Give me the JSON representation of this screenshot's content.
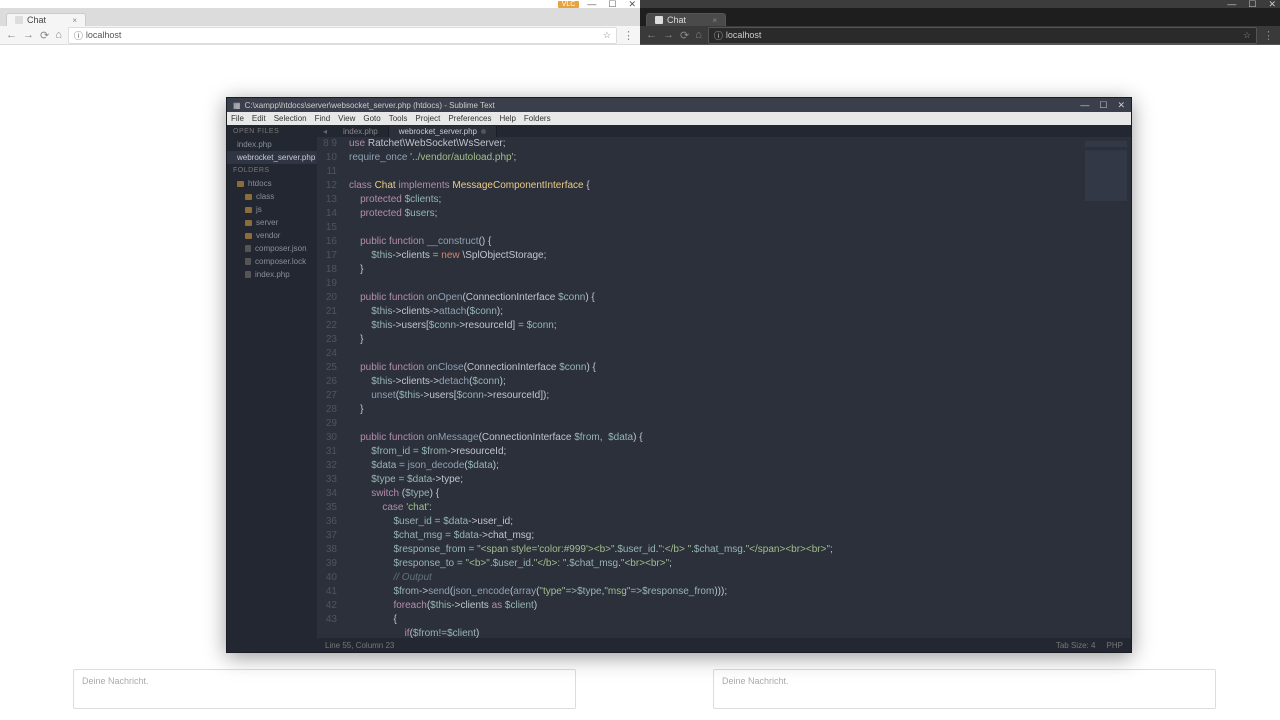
{
  "left_browser": {
    "tab_title": "Chat",
    "url": "localhost",
    "msg_placeholder": "Deine Nachricht.",
    "badge": "VLC"
  },
  "right_browser": {
    "tab_title": "Chat",
    "url": "localhost",
    "msg_placeholder": "Deine Nachricht."
  },
  "editor": {
    "title": "C:\\xampp\\htdocs\\server\\websocket_server.php (htdocs) - Sublime Text",
    "menu": [
      "File",
      "Edit",
      "Selection",
      "Find",
      "View",
      "Goto",
      "Tools",
      "Project",
      "Preferences",
      "Help",
      "Folders"
    ],
    "sidebar": {
      "open_files": "OPEN FILES",
      "files_open": [
        "index.php",
        "webrocket_server.php"
      ],
      "folders": "FOLDERS",
      "root": "htdocs",
      "tree": [
        "class",
        "js",
        "server",
        "vendor",
        "composer.json",
        "composer.lock",
        "index.php"
      ]
    },
    "tabs": [
      "index.php",
      "webrocket_server.php"
    ],
    "status_left": "Line 55, Column 23",
    "status_right_tab": "Tab Size: 4",
    "status_right_lang": "PHP",
    "gutter_start": 8,
    "gutter_end": 43,
    "code_tokens": [
      [
        [
          "kw",
          "use"
        ],
        [
          "var",
          " Ratchet\\WebSocket\\WsServer;"
        ]
      ],
      [
        [
          "fn",
          "require_once"
        ],
        [
          "var",
          " "
        ],
        [
          "str",
          "'../vendor/autoload.php'"
        ],
        [
          "var",
          ";"
        ]
      ],
      [],
      [
        [
          "kw",
          "class"
        ],
        [
          "var",
          " "
        ],
        [
          "cls",
          "Chat"
        ],
        [
          "var",
          " "
        ],
        [
          "kw",
          "implements"
        ],
        [
          "var",
          " "
        ],
        [
          "cls",
          "MessageComponentInterface"
        ],
        [
          "var",
          " {"
        ]
      ],
      [
        [
          "var",
          "    "
        ],
        [
          "kw",
          "protected"
        ],
        [
          "var",
          " "
        ],
        [
          "op",
          "$clients"
        ],
        [
          "var",
          ";"
        ]
      ],
      [
        [
          "var",
          "    "
        ],
        [
          "kw",
          "protected"
        ],
        [
          "var",
          " "
        ],
        [
          "op",
          "$users"
        ],
        [
          "var",
          ";"
        ]
      ],
      [],
      [
        [
          "var",
          "    "
        ],
        [
          "kw",
          "public"
        ],
        [
          "var",
          " "
        ],
        [
          "kw",
          "function"
        ],
        [
          "var",
          " "
        ],
        [
          "fn",
          "__construct"
        ],
        [
          "var",
          "() {"
        ]
      ],
      [
        [
          "var",
          "        "
        ],
        [
          "op",
          "$this"
        ],
        [
          "var",
          "->"
        ],
        [
          "var",
          "clients"
        ],
        [
          "var",
          " "
        ],
        [
          "op",
          "="
        ],
        [
          "var",
          " "
        ],
        [
          "new",
          "new"
        ],
        [
          "var",
          " \\SplObjectStorage;"
        ]
      ],
      [
        [
          "var",
          "    }"
        ]
      ],
      [],
      [
        [
          "var",
          "    "
        ],
        [
          "kw",
          "public"
        ],
        [
          "var",
          " "
        ],
        [
          "kw",
          "function"
        ],
        [
          "var",
          " "
        ],
        [
          "fn",
          "onOpen"
        ],
        [
          "var",
          "(ConnectionInterface "
        ],
        [
          "op",
          "$conn"
        ],
        [
          "var",
          ") {"
        ]
      ],
      [
        [
          "var",
          "        "
        ],
        [
          "op",
          "$this"
        ],
        [
          "var",
          "->clients->"
        ],
        [
          "fn",
          "attach"
        ],
        [
          "var",
          "("
        ],
        [
          "op",
          "$conn"
        ],
        [
          "var",
          ");"
        ]
      ],
      [
        [
          "var",
          "        "
        ],
        [
          "op",
          "$this"
        ],
        [
          "var",
          "->users["
        ],
        [
          "op",
          "$conn"
        ],
        [
          "var",
          "->resourceId] "
        ],
        [
          "op",
          "="
        ],
        [
          "var",
          " "
        ],
        [
          "op",
          "$conn"
        ],
        [
          "var",
          ";"
        ]
      ],
      [
        [
          "var",
          "    }"
        ]
      ],
      [],
      [
        [
          "var",
          "    "
        ],
        [
          "kw",
          "public"
        ],
        [
          "var",
          " "
        ],
        [
          "kw",
          "function"
        ],
        [
          "var",
          " "
        ],
        [
          "fn",
          "onClose"
        ],
        [
          "var",
          "(ConnectionInterface "
        ],
        [
          "op",
          "$conn"
        ],
        [
          "var",
          ") {"
        ]
      ],
      [
        [
          "var",
          "        "
        ],
        [
          "op",
          "$this"
        ],
        [
          "var",
          "->clients->"
        ],
        [
          "fn",
          "detach"
        ],
        [
          "var",
          "("
        ],
        [
          "op",
          "$conn"
        ],
        [
          "var",
          ");"
        ]
      ],
      [
        [
          "var",
          "        "
        ],
        [
          "fn",
          "unset"
        ],
        [
          "var",
          "("
        ],
        [
          "op",
          "$this"
        ],
        [
          "var",
          "->users["
        ],
        [
          "op",
          "$conn"
        ],
        [
          "var",
          "->resourceId]);"
        ]
      ],
      [
        [
          "var",
          "    }"
        ]
      ],
      [],
      [
        [
          "var",
          "    "
        ],
        [
          "kw",
          "public"
        ],
        [
          "var",
          " "
        ],
        [
          "kw",
          "function"
        ],
        [
          "var",
          " "
        ],
        [
          "fn",
          "onMessage"
        ],
        [
          "var",
          "(ConnectionInterface "
        ],
        [
          "op",
          "$from"
        ],
        [
          "var",
          ",  "
        ],
        [
          "op",
          "$data"
        ],
        [
          "var",
          ") {"
        ]
      ],
      [
        [
          "var",
          "        "
        ],
        [
          "op",
          "$from_id"
        ],
        [
          "var",
          " "
        ],
        [
          "op",
          "="
        ],
        [
          "var",
          " "
        ],
        [
          "op",
          "$from"
        ],
        [
          "var",
          "->resourceId;"
        ]
      ],
      [
        [
          "var",
          "        "
        ],
        [
          "op",
          "$data"
        ],
        [
          "var",
          " "
        ],
        [
          "op",
          "="
        ],
        [
          "var",
          " "
        ],
        [
          "fn",
          "json_decode"
        ],
        [
          "var",
          "("
        ],
        [
          "op",
          "$data"
        ],
        [
          "var",
          ");"
        ]
      ],
      [
        [
          "var",
          "        "
        ],
        [
          "op",
          "$type"
        ],
        [
          "var",
          " "
        ],
        [
          "op",
          "="
        ],
        [
          "var",
          " "
        ],
        [
          "op",
          "$data"
        ],
        [
          "var",
          "->type;"
        ]
      ],
      [
        [
          "var",
          "        "
        ],
        [
          "kw",
          "switch"
        ],
        [
          "var",
          " ("
        ],
        [
          "op",
          "$type"
        ],
        [
          "var",
          ") {"
        ]
      ],
      [
        [
          "var",
          "            "
        ],
        [
          "kw",
          "case"
        ],
        [
          "var",
          " "
        ],
        [
          "str",
          "'chat'"
        ],
        [
          "var",
          ":"
        ]
      ],
      [
        [
          "var",
          "                "
        ],
        [
          "op",
          "$user_id"
        ],
        [
          "var",
          " "
        ],
        [
          "op",
          "="
        ],
        [
          "var",
          " "
        ],
        [
          "op",
          "$data"
        ],
        [
          "var",
          "->user_id;"
        ]
      ],
      [
        [
          "var",
          "                "
        ],
        [
          "op",
          "$chat_msg"
        ],
        [
          "var",
          " "
        ],
        [
          "op",
          "="
        ],
        [
          "var",
          " "
        ],
        [
          "op",
          "$data"
        ],
        [
          "var",
          "->chat_msg;"
        ]
      ],
      [
        [
          "var",
          "                "
        ],
        [
          "op",
          "$response_from"
        ],
        [
          "var",
          " "
        ],
        [
          "op",
          "="
        ],
        [
          "var",
          " "
        ],
        [
          "str",
          "\"<span style='color:#999'><b>\""
        ],
        [
          "var",
          "."
        ],
        [
          "op",
          "$user_id"
        ],
        [
          "var",
          "."
        ],
        [
          "str",
          "\":</b> \""
        ],
        [
          "var",
          "."
        ],
        [
          "op",
          "$chat_msg"
        ],
        [
          "var",
          "."
        ],
        [
          "str",
          "\"</span><br><br>\""
        ],
        [
          "var",
          ";"
        ]
      ],
      [
        [
          "var",
          "                "
        ],
        [
          "op",
          "$response_to"
        ],
        [
          "var",
          " "
        ],
        [
          "op",
          "="
        ],
        [
          "var",
          " "
        ],
        [
          "str",
          "\"<b>\""
        ],
        [
          "var",
          "."
        ],
        [
          "op",
          "$user_id"
        ],
        [
          "var",
          "."
        ],
        [
          "str",
          "\"</b>: \""
        ],
        [
          "var",
          "."
        ],
        [
          "op",
          "$chat_msg"
        ],
        [
          "var",
          "."
        ],
        [
          "str",
          "\"<br><br>\""
        ],
        [
          "var",
          ";"
        ]
      ],
      [
        [
          "var",
          "                "
        ],
        [
          "cm",
          "// Output"
        ]
      ],
      [
        [
          "var",
          "                "
        ],
        [
          "op",
          "$from"
        ],
        [
          "var",
          "->"
        ],
        [
          "fn",
          "send"
        ],
        [
          "var",
          "("
        ],
        [
          "fn",
          "json_encode"
        ],
        [
          "var",
          "("
        ],
        [
          "fn",
          "array"
        ],
        [
          "var",
          "("
        ],
        [
          "str",
          "\"type\""
        ],
        [
          "op",
          "=>"
        ],
        [
          "op",
          "$type"
        ],
        [
          "var",
          ","
        ],
        [
          "str",
          "\"msg\""
        ],
        [
          "op",
          "=>"
        ],
        [
          "op",
          "$response_from"
        ],
        [
          "var",
          ")));"
        ]
      ],
      [
        [
          "var",
          "                "
        ],
        [
          "kw",
          "foreach"
        ],
        [
          "var",
          "("
        ],
        [
          "op",
          "$this"
        ],
        [
          "var",
          "->clients "
        ],
        [
          "kw",
          "as"
        ],
        [
          "var",
          " "
        ],
        [
          "op",
          "$client"
        ],
        [
          "var",
          ")"
        ]
      ],
      [
        [
          "var",
          "                {"
        ]
      ],
      [
        [
          "var",
          "                    "
        ],
        [
          "kw",
          "if"
        ],
        [
          "var",
          "("
        ],
        [
          "op",
          "$from"
        ],
        [
          "op",
          "!="
        ],
        [
          "op",
          "$client"
        ],
        [
          "var",
          ")"
        ]
      ]
    ]
  }
}
